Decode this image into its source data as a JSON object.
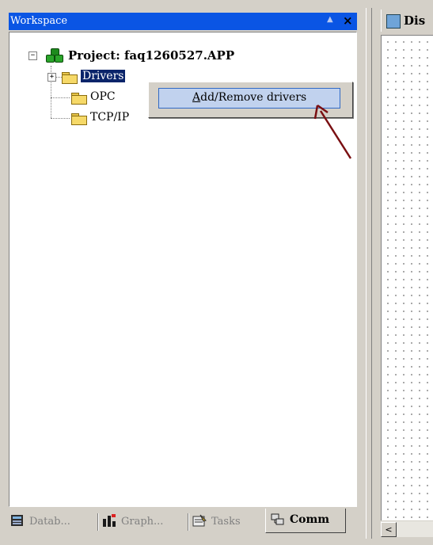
{
  "workspace": {
    "title": "Workspace",
    "pin_icon": "▲",
    "close_icon": "×"
  },
  "tree": {
    "root": {
      "label": "Project: faq1260527.APP",
      "expander": "−",
      "icon": "project-icon"
    },
    "children": [
      {
        "label": "Drivers",
        "expander": "+",
        "selected": true,
        "icon": "folder-icon"
      },
      {
        "label": "OPC",
        "icon": "folder-icon"
      },
      {
        "label": "TCP/IP",
        "icon": "folder-icon"
      }
    ]
  },
  "context_menu": {
    "items": [
      {
        "label_mnemonic": "A",
        "label_rest": "dd/Remove drivers",
        "highlighted": true
      }
    ]
  },
  "tabs": [
    {
      "label": "Datab...",
      "icon": "database-icon"
    },
    {
      "label": "Graph...",
      "icon": "graphics-icon"
    },
    {
      "label": "Tasks",
      "icon": "tasks-icon"
    },
    {
      "label": "Comm",
      "icon": "comm-icon",
      "active": true
    }
  ],
  "right_panel": {
    "tab_label": "Dis",
    "scroll_left_glyph": "<"
  },
  "colors": {
    "title_bar": "#0a55e4",
    "selection": "#0a246a",
    "menu_highlight": "#c1d2ee",
    "annotation_arrow": "#7a0f12"
  }
}
